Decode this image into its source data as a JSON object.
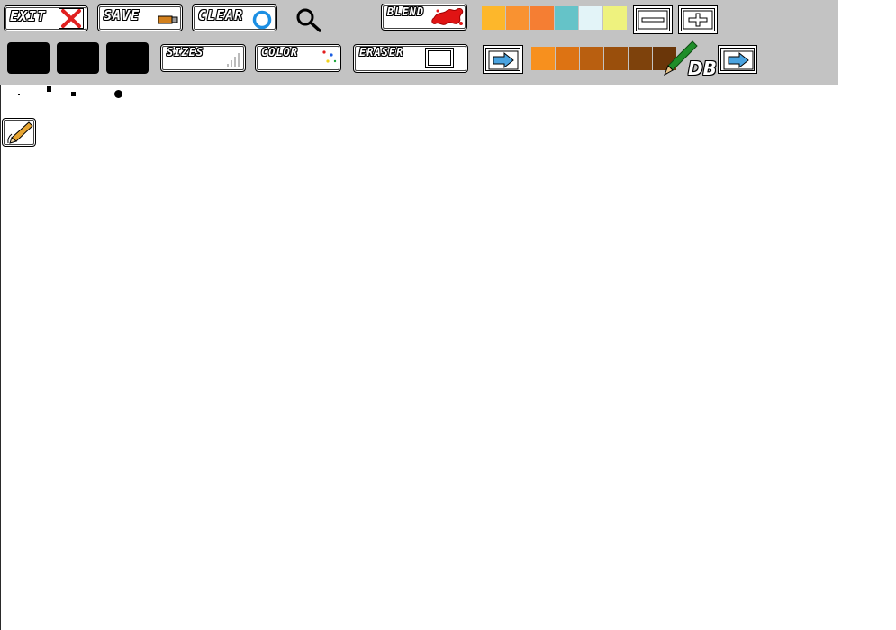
{
  "toolbar": {
    "exit_label": "EXIT",
    "save_label": "SAVE",
    "clear_label": "CLEAR",
    "blend_label": "BLEND",
    "sizes_label": "SIZES",
    "color_label": "COLOR",
    "eraser_label": "ERASER",
    "logo_text": "DB"
  },
  "icons": {
    "exit": "red-x-icon",
    "save": "usb-drive-icon",
    "clear": "blue-ring-icon",
    "zoom": "magnifier-icon",
    "blend": "red-splat-icon",
    "zoom_out": "minus-icon",
    "zoom_in": "plus-icon",
    "next_palette": "arrow-right-icon",
    "pencil": "pencil-icon"
  },
  "palette_top": [
    "#fdb72b",
    "#f99231",
    "#f57e33",
    "#65c3c8",
    "#e3f4f8",
    "#eef27e"
  ],
  "palette_bottom": [
    "#f7901e",
    "#dd7313",
    "#b95f10",
    "#9a4f0c",
    "#7e420c",
    "#6a3609"
  ],
  "recent_colors": [
    "#000000",
    "#000000",
    "#000000"
  ],
  "brush_sizes": [
    "tiny",
    "small",
    "medium",
    "large"
  ]
}
